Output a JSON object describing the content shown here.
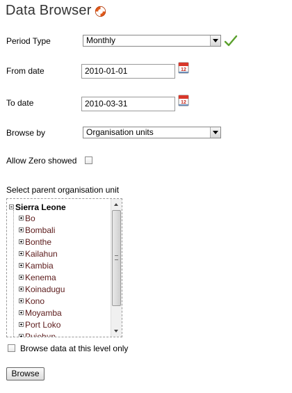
{
  "page": {
    "title": "Data Browser",
    "help_icon": "lifebuoy-icon"
  },
  "period_type": {
    "label": "Period Type",
    "value": "Monthly",
    "status_icon": "checkmark-icon",
    "status_color": "#5aa02c"
  },
  "from_date": {
    "label": "From date",
    "value": "2010-01-01",
    "picker_icon": "calendar-icon"
  },
  "to_date": {
    "label": "To date",
    "value": "2010-03-31",
    "picker_icon": "calendar-icon"
  },
  "browse_by": {
    "label": "Browse by",
    "value": "Organisation units"
  },
  "allow_zero": {
    "label": "Allow Zero showed",
    "checked": false
  },
  "org_tree": {
    "label": "Select parent organisation unit",
    "root": "Sierra Leone",
    "children": [
      "Bo",
      "Bombali",
      "Bonthe",
      "Kailahun",
      "Kambia",
      "Kenema",
      "Koinadugu",
      "Kono",
      "Moyamba",
      "Port Loko",
      "Pujehun"
    ]
  },
  "level_only": {
    "label": "Browse data at this level only",
    "checked": false
  },
  "browse_button": {
    "label": "Browse"
  }
}
